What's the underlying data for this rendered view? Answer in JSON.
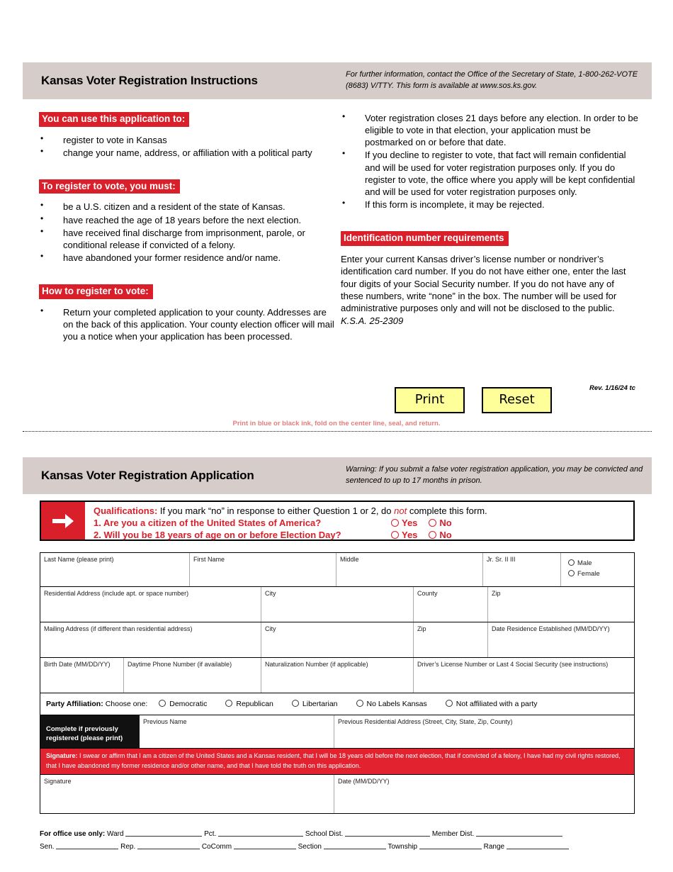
{
  "instructions": {
    "title": "Kansas Voter Registration Instructions",
    "contact_note": "For further information, contact the Office of the Secretary of State, 1-800-262-VOTE (8683) V/TTY. This form is available at www.sos.ks.gov.",
    "section_use": {
      "heading": "You can use this application to:",
      "items": [
        "register to vote in Kansas",
        "change your name, address, or affiliation with a political party"
      ]
    },
    "section_must": {
      "heading": "To register to vote, you must:",
      "items": [
        "be a U.S. citizen and a resident of the state of Kansas.",
        "have reached the age of 18 years before the next election.",
        "have received final discharge from imprisonment, parole, or conditional release if convicted of a felony.",
        "have abandoned your former residence and/or name."
      ]
    },
    "section_how": {
      "heading": "How to register to vote:",
      "items": [
        "Return your completed application to your county. Addresses are on the back of this application. Your county election officer will mail you a notice when your application has been processed."
      ]
    },
    "right_bullets": [
      "Voter registration closes 21 days before any election. In order to be eligible to vote in that election, your application must be postmarked on or before that date.",
      "If you decline to register to vote, that fact will remain confidential and will be used for voter registration purposes only. If you do register to vote, the office where you apply will be kept confidential and will be used for voter registration purposes only.",
      "If this form is incomplete, it may be rejected."
    ],
    "section_id": {
      "heading": "Identification number requirements",
      "body": "Enter your current Kansas driver’s license number or nondriver’s identification card number. If you do not have either one, enter the last four digits of your Social Security number. If you do not have any of these numbers, write “none” in the box. The number will be used for administrative purposes only and will not be disclosed to the public.",
      "citation": "K.S.A. 25-2309"
    },
    "buttons": {
      "print": "Print",
      "reset": "Reset"
    },
    "revision": "Rev. 1/16/24 tc",
    "fold_note": "Print in blue or black ink, fold on the center line, seal, and return."
  },
  "application": {
    "title": "Kansas Voter Registration Application",
    "warning": "Warning: If you submit a false voter registration application, you may be convicted and sentenced to up to 17 months in prison.",
    "qualifications": {
      "icon": "arrow-right-icon",
      "lead_label": "Qualifications:",
      "lead_text_a": " If you mark “no” in response to either Question 1 or 2, do ",
      "lead_not": "not",
      "lead_text_b": " complete this form.",
      "question1": "1. Are you a citizen of the United States of America?",
      "question2": "2. Will you be 18 years of age on or before Election Day?",
      "yes_label": "Yes",
      "no_label": "No"
    },
    "fields": {
      "last_name": "Last Name (please print)",
      "first_name": "First Name",
      "middle": "Middle",
      "suffix": "Jr. Sr. II III",
      "male": "Male",
      "female": "Female",
      "residential_address": "Residential Address (include apt. or space number)",
      "city1": "City",
      "county": "County",
      "zip1": "Zip",
      "mailing_address": "Mailing Address (if different than residential address)",
      "city2": "City",
      "zip2": "Zip",
      "date_residence": "Date Residence Established (MM/DD/YY)",
      "birth_date": "Birth Date (MM/DD/YY)",
      "daytime_phone": "Daytime Phone Number (if available)",
      "naturalization": "Naturalization Number (if applicable)",
      "drivers_license": "Driver’s License Number or Last 4 Social Security (see instructions)",
      "previous_name": "Previous Name",
      "previous_address": "Previous Residential Address (Street, City, State, Zip, County)",
      "signature": "Signature",
      "date_signed": "Date (MM/DD/YY)"
    },
    "party": {
      "label": "Party Affiliation:",
      "choose": "Choose one:",
      "options": [
        "Democratic",
        "Republican",
        "Libertarian",
        "No Labels Kansas",
        "Not affiliated with a party"
      ]
    },
    "previous_block_label": "Complete if previously registered (please print)",
    "signature_strip": {
      "label": "Signature:",
      "text": " I swear or affirm that I am a citizen of the United States and a Kansas resident, that I will be 18 years old before the next election, that if convicted of a felony, I have had my civil rights restored, that I have abandoned my former residence and/or other name, and that I have told the truth on this application."
    },
    "office_use": {
      "label": "For office use only:",
      "row1": [
        "Ward",
        "Pct.",
        "School Dist.",
        "Member Dist."
      ],
      "row2": [
        "Sen.",
        "Rep.",
        "CoComm",
        "Section",
        "Township",
        "Range"
      ]
    }
  },
  "colors": {
    "red": "#d81f2a",
    "red_strip": "#e32230",
    "grey_bar": "#d6ccc9",
    "button_yellow": "#ffff99",
    "fold_note_pink": "#e87b7b"
  }
}
